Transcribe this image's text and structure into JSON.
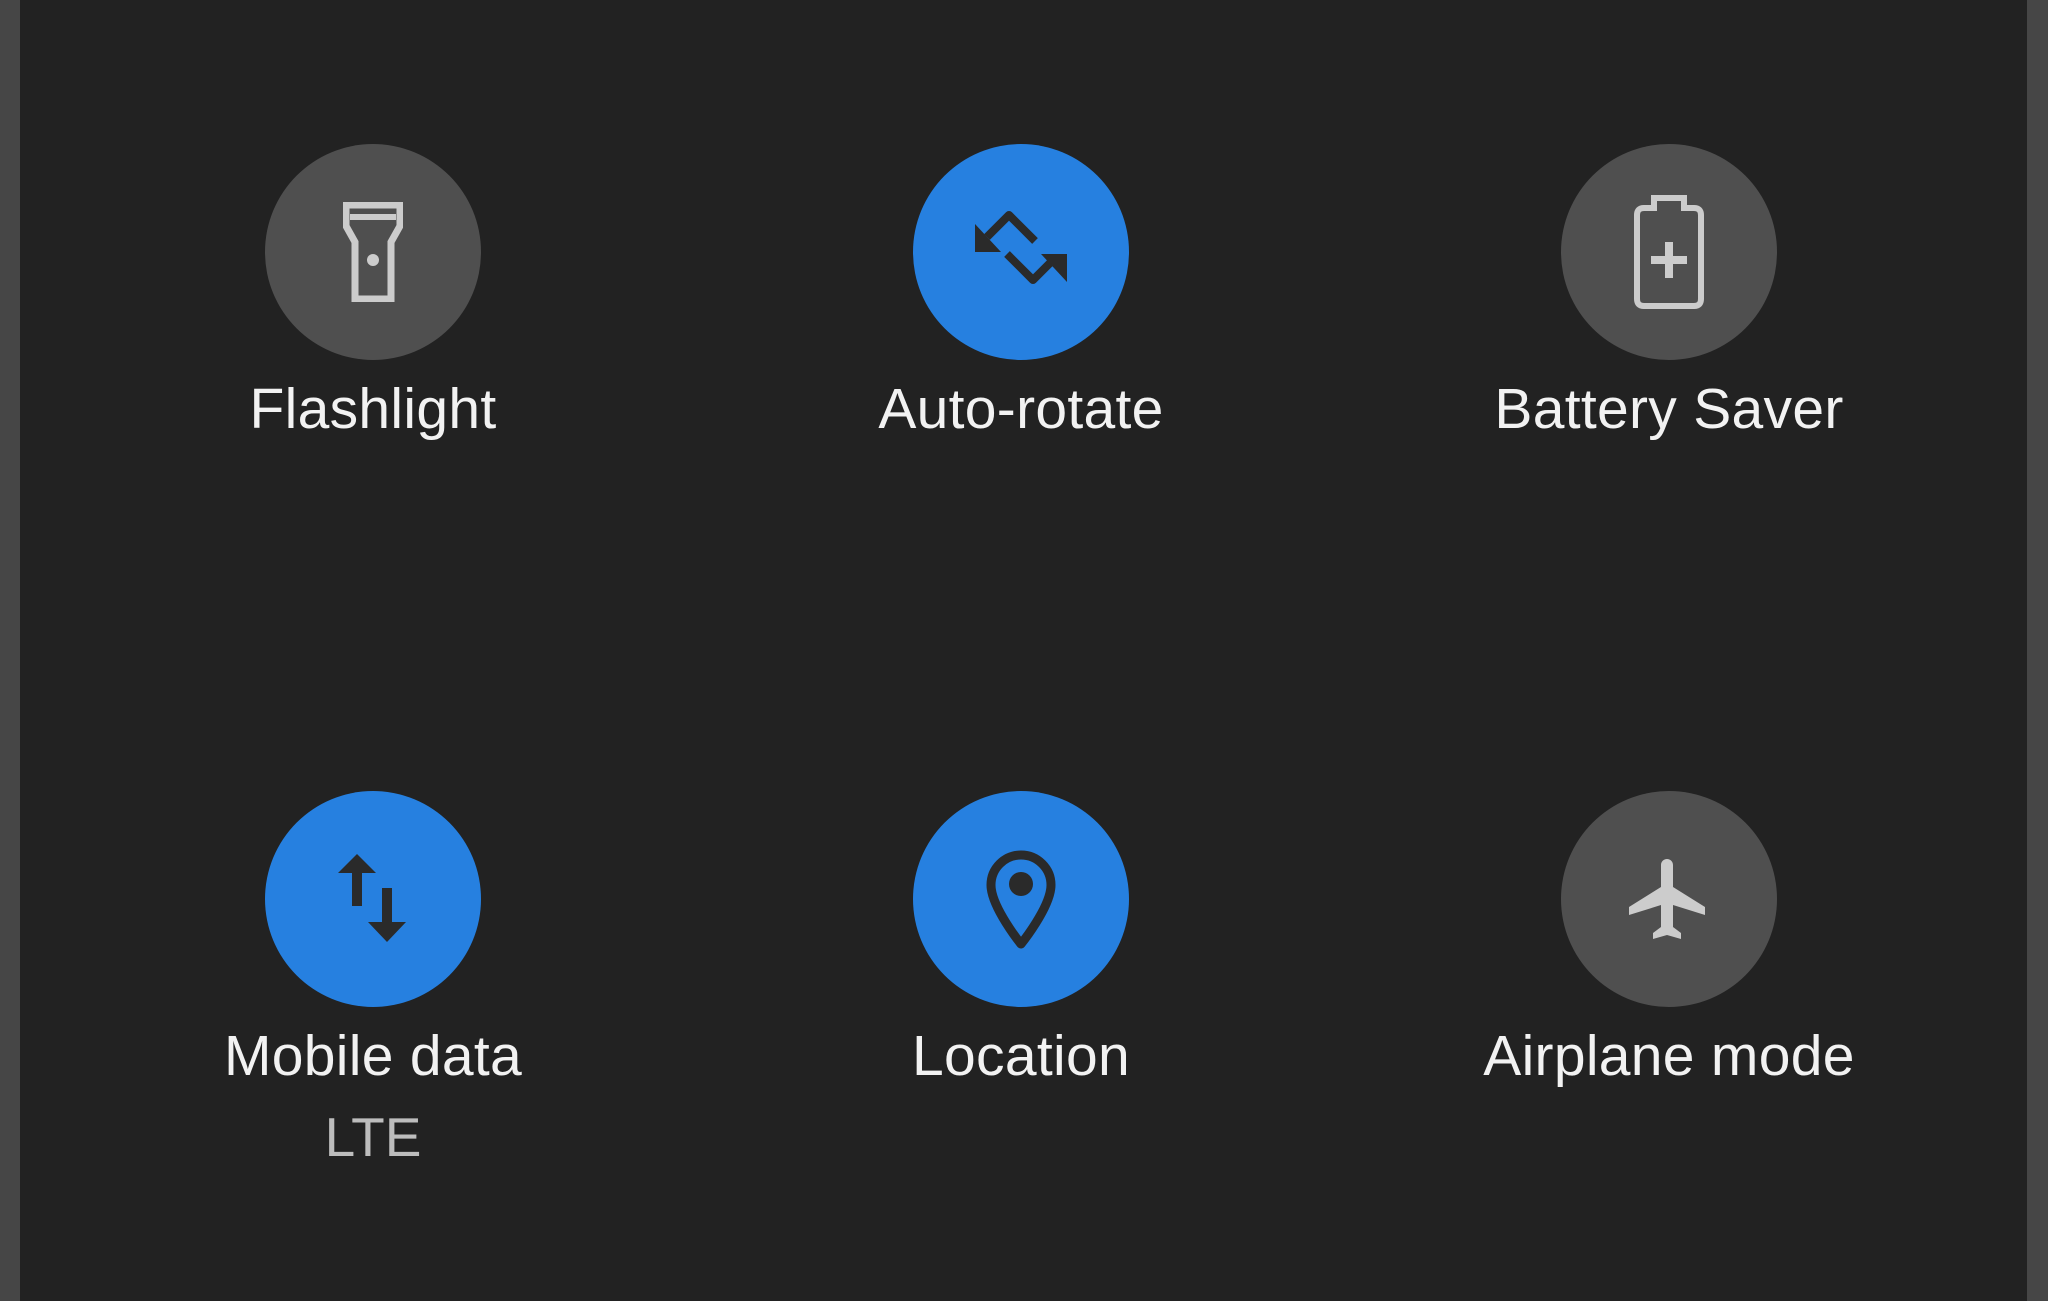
{
  "quick_settings": {
    "colors": {
      "background": "#222222",
      "tile_off": "#4f4f4f",
      "tile_on": "#2680e0",
      "icon_off": "#cccccc",
      "icon_on": "#2a2a2a",
      "label": "#f2f2f2",
      "sublabel": "#bdbdbd"
    },
    "tiles": [
      {
        "label": "Flashlight",
        "icon": "flashlight-icon",
        "state": "off"
      },
      {
        "label": "Auto-rotate",
        "icon": "screen-rotation-icon",
        "state": "on"
      },
      {
        "label": "Battery Saver",
        "icon": "battery-plus-icon",
        "state": "off"
      },
      {
        "label": "Mobile data",
        "sublabel": "LTE",
        "icon": "mobile-data-arrows-icon",
        "state": "on"
      },
      {
        "label": "Location",
        "icon": "location-pin-icon",
        "state": "on"
      },
      {
        "label": "Airplane mode",
        "icon": "airplane-icon",
        "state": "off"
      }
    ]
  }
}
